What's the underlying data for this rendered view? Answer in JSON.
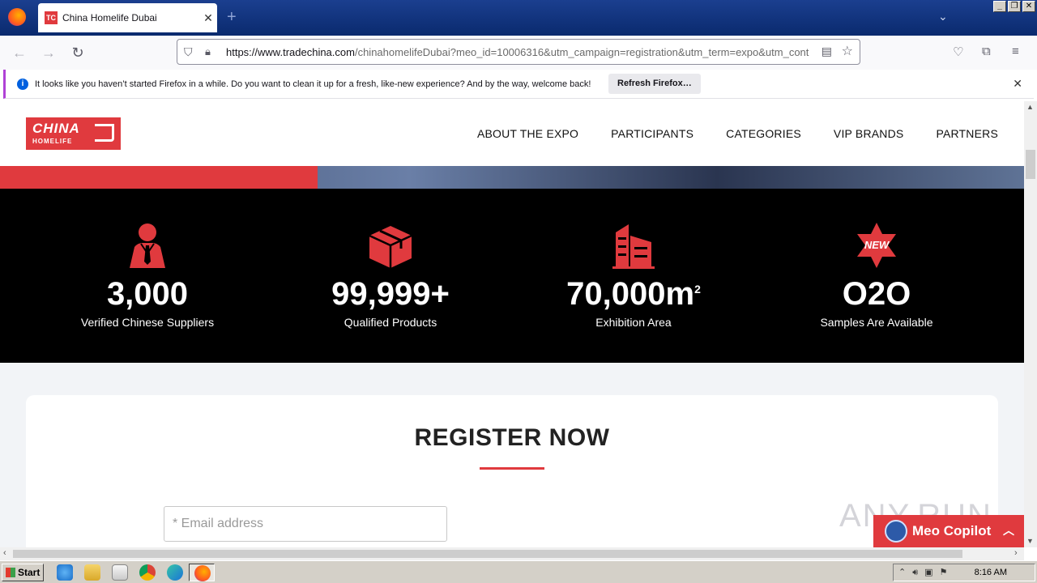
{
  "browser": {
    "tab_title": "China Homelife Dubai",
    "tab_favicon_text": "TC",
    "url_host": "https://www.tradechina.com",
    "url_rest": "/chinahomelifeDubai?meo_id=10006316&utm_campaign=registration&utm_term=expo&utm_cont",
    "notification": {
      "message": "It looks like you haven’t started Firefox in a while. Do you want to clean it up for a fresh, like-new experience? And by the way, welcome back!",
      "button": "Refresh Firefox…"
    }
  },
  "site": {
    "logo_line1": "CHINA",
    "logo_line2": "HOMELIFE",
    "nav": [
      "ABOUT THE EXPO",
      "PARTICIPANTS",
      "CATEGORIES",
      "VIP BRANDS",
      "PARTNERS"
    ],
    "stats": [
      {
        "value": "3,000",
        "label": "Verified Chinese Suppliers",
        "icon": "supplier-person-icon"
      },
      {
        "value": "99,999+",
        "label": "Qualified Products",
        "icon": "product-box-icon"
      },
      {
        "value": "70,000m",
        "sup": "2",
        "label": "Exhibition Area",
        "icon": "building-icon"
      },
      {
        "value": "O2O",
        "label": "Samples Are Available",
        "icon": "new-badge-icon",
        "badge": "NEW"
      }
    ],
    "register": {
      "title": "REGISTER NOW",
      "email_placeholder": "* Email address"
    },
    "copilot_label": "Meo Copilot",
    "watermark": "ANY.RUN"
  },
  "taskbar": {
    "start_label": "Start",
    "clock": "8:16 AM"
  },
  "colors": {
    "accent_red": "#e03a3e",
    "stats_bg": "#000000"
  }
}
